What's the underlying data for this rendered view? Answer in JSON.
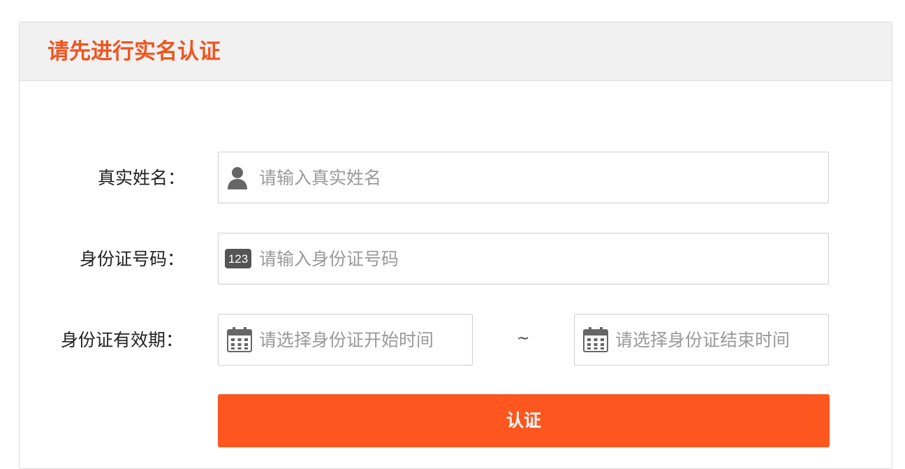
{
  "header": {
    "title": "请先进行实名认证"
  },
  "form": {
    "name": {
      "label": "真实姓名：",
      "placeholder": "请输入真实姓名",
      "value": "",
      "icon": "user-icon"
    },
    "id_number": {
      "label": "身份证号码：",
      "placeholder": "请输入身份证号码",
      "value": "",
      "icon": "numeric-123-icon",
      "icon_text": "123"
    },
    "validity": {
      "label": "身份证有效期：",
      "separator": "~",
      "start": {
        "placeholder": "请选择身份证开始时间",
        "value": "",
        "icon": "calendar-icon"
      },
      "end": {
        "placeholder": "请选择身份证结束时间",
        "value": "",
        "icon": "calendar-icon"
      }
    },
    "submit_label": "认证"
  },
  "colors": {
    "accent": "#fd561f",
    "title": "#f0541e",
    "header_bg": "#f1f1f1",
    "border": "#cfcfcf",
    "placeholder": "#9a9a9a",
    "icon": "#666666"
  }
}
